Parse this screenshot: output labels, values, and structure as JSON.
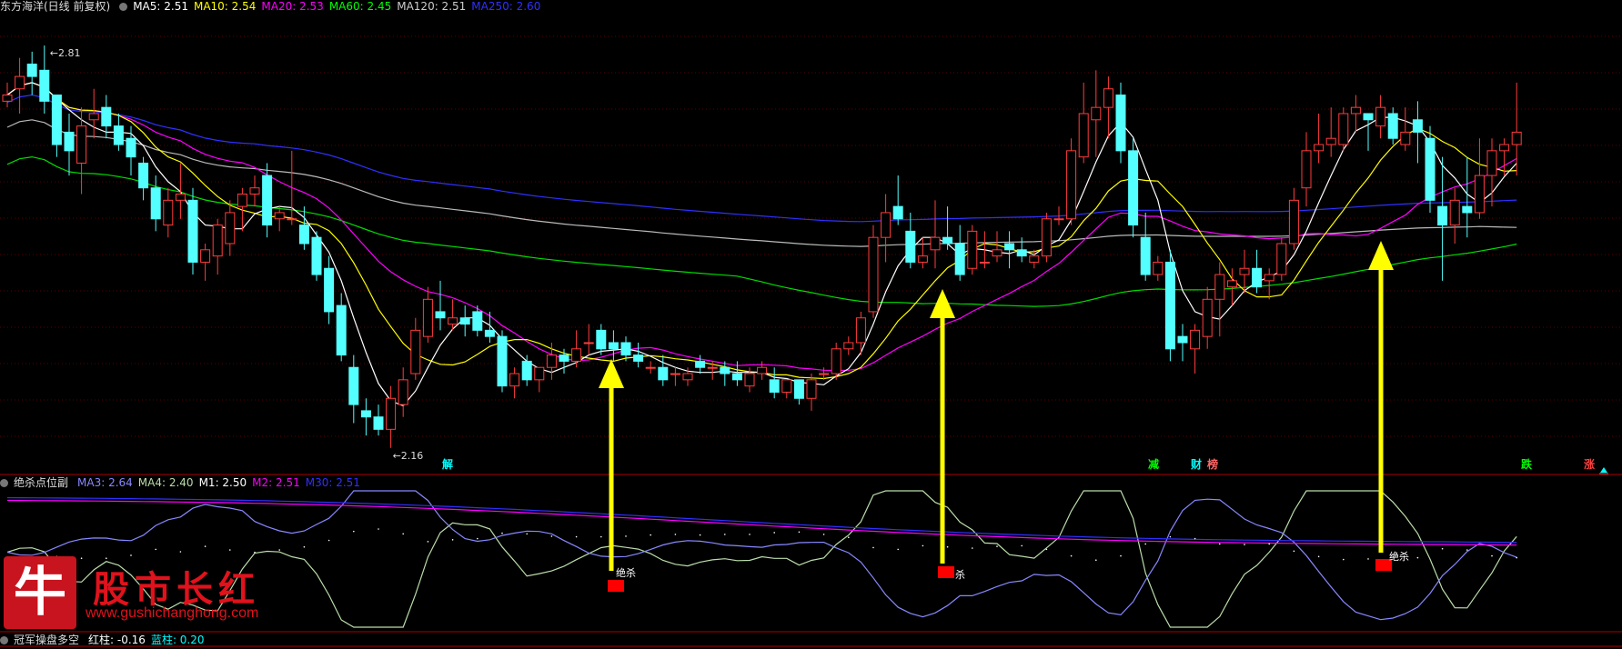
{
  "main_header": {
    "title": "东方海洋(日线 前复权)",
    "indicators": [
      {
        "label": "MA5: 2.51",
        "color": "#ffffff"
      },
      {
        "label": "MA10: 2.54",
        "color": "#ffff00"
      },
      {
        "label": "MA20: 2.53",
        "color": "#ff00ff"
      },
      {
        "label": "MA60: 2.45",
        "color": "#00ff00"
      },
      {
        "label": "MA120: 2.51",
        "color": "#cccccc"
      },
      {
        "label": "MA250: 2.60",
        "color": "#3030ff"
      }
    ]
  },
  "sub_header": {
    "title": "绝杀点位副",
    "indicators": [
      {
        "label": "MA3: 2.64",
        "color": "#8888ff"
      },
      {
        "label": "MA4: 2.40",
        "color": "#bbddaa"
      },
      {
        "label": "M1: 2.50",
        "color": "#ffffff"
      },
      {
        "label": "M2: 2.51",
        "color": "#ff00ff"
      },
      {
        "label": "M30: 2.51",
        "color": "#3030ff"
      }
    ]
  },
  "bottom_header": {
    "title": "冠军操盘多空",
    "indicators": [
      {
        "label": "红柱: -0.16",
        "color": "#ffffff"
      },
      {
        "label": "蓝柱: 0.20",
        "color": "#00ffff"
      }
    ]
  },
  "chart_data": {
    "type": "candlestick",
    "ylim": [
      2.12,
      2.86
    ],
    "high_label": "2.81",
    "low_label": "2.16",
    "candles": [
      [
        2.72,
        2.75,
        2.71,
        2.73
      ],
      [
        2.74,
        2.79,
        2.7,
        2.76
      ],
      [
        2.78,
        2.8,
        2.73,
        2.76
      ],
      [
        2.77,
        2.81,
        2.7,
        2.72
      ],
      [
        2.73,
        2.73,
        2.63,
        2.65
      ],
      [
        2.67,
        2.7,
        2.6,
        2.64
      ],
      [
        2.62,
        2.71,
        2.57,
        2.68
      ],
      [
        2.69,
        2.74,
        2.66,
        2.7
      ],
      [
        2.71,
        2.73,
        2.66,
        2.68
      ],
      [
        2.68,
        2.7,
        2.64,
        2.65
      ],
      [
        2.66,
        2.68,
        2.6,
        2.63
      ],
      [
        2.62,
        2.63,
        2.56,
        2.58
      ],
      [
        2.58,
        2.6,
        2.51,
        2.53
      ],
      [
        2.52,
        2.58,
        2.5,
        2.56
      ],
      [
        2.56,
        2.62,
        2.53,
        2.57
      ],
      [
        2.56,
        2.58,
        2.44,
        2.46
      ],
      [
        2.46,
        2.49,
        2.43,
        2.48
      ],
      [
        2.47,
        2.53,
        2.44,
        2.52
      ],
      [
        2.49,
        2.56,
        2.47,
        2.54
      ],
      [
        2.55,
        2.58,
        2.51,
        2.57
      ],
      [
        2.57,
        2.6,
        2.55,
        2.58
      ],
      [
        2.6,
        2.62,
        2.5,
        2.52
      ],
      [
        2.53,
        2.55,
        2.51,
        2.54
      ],
      [
        2.53,
        2.64,
        2.52,
        2.53
      ],
      [
        2.52,
        2.55,
        2.48,
        2.49
      ],
      [
        2.5,
        2.51,
        2.43,
        2.44
      ],
      [
        2.45,
        2.47,
        2.36,
        2.38
      ],
      [
        2.39,
        2.41,
        2.3,
        2.31
      ],
      [
        2.29,
        2.31,
        2.2,
        2.23
      ],
      [
        2.22,
        2.24,
        2.18,
        2.21
      ],
      [
        2.21,
        2.23,
        2.18,
        2.19
      ],
      [
        2.19,
        2.26,
        2.16,
        2.24
      ],
      [
        2.23,
        2.29,
        2.21,
        2.27
      ],
      [
        2.28,
        2.37,
        2.27,
        2.35
      ],
      [
        2.34,
        2.42,
        2.33,
        2.4
      ],
      [
        2.38,
        2.43,
        2.35,
        2.37
      ],
      [
        2.36,
        2.4,
        2.35,
        2.37
      ],
      [
        2.37,
        2.39,
        2.34,
        2.36
      ],
      [
        2.38,
        2.39,
        2.34,
        2.35
      ],
      [
        2.35,
        2.38,
        2.33,
        2.34
      ],
      [
        2.34,
        2.35,
        2.25,
        2.26
      ],
      [
        2.26,
        2.29,
        2.24,
        2.28
      ],
      [
        2.3,
        2.31,
        2.26,
        2.27
      ],
      [
        2.27,
        2.29,
        2.25,
        2.29
      ],
      [
        2.29,
        2.33,
        2.27,
        2.31
      ],
      [
        2.31,
        2.32,
        2.28,
        2.3
      ],
      [
        2.3,
        2.35,
        2.29,
        2.32
      ],
      [
        2.33,
        2.36,
        2.31,
        2.33
      ],
      [
        2.35,
        2.36,
        2.31,
        2.32
      ],
      [
        2.33,
        2.35,
        2.3,
        2.32
      ],
      [
        2.33,
        2.34,
        2.3,
        2.31
      ],
      [
        2.31,
        2.33,
        2.29,
        2.3
      ],
      [
        2.29,
        2.3,
        2.28,
        2.29
      ],
      [
        2.29,
        2.31,
        2.26,
        2.27
      ],
      [
        2.28,
        2.29,
        2.26,
        2.28
      ],
      [
        2.27,
        2.29,
        2.26,
        2.28
      ],
      [
        2.3,
        2.31,
        2.28,
        2.29
      ],
      [
        2.29,
        2.3,
        2.27,
        2.29
      ],
      [
        2.29,
        2.3,
        2.26,
        2.28
      ],
      [
        2.28,
        2.3,
        2.26,
        2.27
      ],
      [
        2.26,
        2.29,
        2.25,
        2.28
      ],
      [
        2.28,
        2.3,
        2.27,
        2.29
      ],
      [
        2.27,
        2.29,
        2.24,
        2.25
      ],
      [
        2.25,
        2.27,
        2.24,
        2.27
      ],
      [
        2.27,
        2.27,
        2.23,
        2.24
      ],
      [
        2.24,
        2.28,
        2.22,
        2.27
      ],
      [
        2.28,
        2.29,
        2.27,
        2.28
      ],
      [
        2.28,
        2.33,
        2.27,
        2.32
      ],
      [
        2.32,
        2.34,
        2.31,
        2.33
      ],
      [
        2.33,
        2.38,
        2.31,
        2.37
      ],
      [
        2.38,
        2.52,
        2.37,
        2.5
      ],
      [
        2.5,
        2.57,
        2.46,
        2.54
      ],
      [
        2.55,
        2.6,
        2.52,
        2.53
      ],
      [
        2.51,
        2.54,
        2.45,
        2.46
      ],
      [
        2.46,
        2.5,
        2.45,
        2.47
      ],
      [
        2.48,
        2.56,
        2.45,
        2.5
      ],
      [
        2.5,
        2.55,
        2.48,
        2.49
      ],
      [
        2.49,
        2.52,
        2.43,
        2.44
      ],
      [
        2.45,
        2.52,
        2.44,
        2.51
      ],
      [
        2.46,
        2.51,
        2.45,
        2.46
      ],
      [
        2.47,
        2.51,
        2.46,
        2.48
      ],
      [
        2.49,
        2.51,
        2.45,
        2.48
      ],
      [
        2.48,
        2.5,
        2.46,
        2.47
      ],
      [
        2.46,
        2.48,
        2.45,
        2.47
      ],
      [
        2.47,
        2.54,
        2.46,
        2.53
      ],
      [
        2.53,
        2.55,
        2.52,
        2.53
      ],
      [
        2.53,
        2.66,
        2.52,
        2.64
      ],
      [
        2.63,
        2.75,
        2.62,
        2.7
      ],
      [
        2.69,
        2.77,
        2.63,
        2.71
      ],
      [
        2.71,
        2.76,
        2.66,
        2.74
      ],
      [
        2.73,
        2.75,
        2.62,
        2.64
      ],
      [
        2.64,
        2.66,
        2.5,
        2.52
      ],
      [
        2.5,
        2.54,
        2.43,
        2.44
      ],
      [
        2.44,
        2.47,
        2.43,
        2.46
      ],
      [
        2.46,
        2.48,
        2.3,
        2.32
      ],
      [
        2.34,
        2.36,
        2.3,
        2.33
      ],
      [
        2.32,
        2.36,
        2.28,
        2.35
      ],
      [
        2.34,
        2.42,
        2.32,
        2.4
      ],
      [
        2.4,
        2.46,
        2.34,
        2.44
      ],
      [
        2.42,
        2.45,
        2.39,
        2.43
      ],
      [
        2.44,
        2.48,
        2.41,
        2.45
      ],
      [
        2.45,
        2.48,
        2.41,
        2.42
      ],
      [
        2.43,
        2.45,
        2.4,
        2.44
      ],
      [
        2.44,
        2.5,
        2.43,
        2.49
      ],
      [
        2.49,
        2.58,
        2.48,
        2.56
      ],
      [
        2.58,
        2.67,
        2.55,
        2.64
      ],
      [
        2.64,
        2.7,
        2.62,
        2.65
      ],
      [
        2.65,
        2.71,
        2.63,
        2.66
      ],
      [
        2.65,
        2.71,
        2.64,
        2.7
      ],
      [
        2.7,
        2.73,
        2.67,
        2.71
      ],
      [
        2.7,
        2.7,
        2.64,
        2.69
      ],
      [
        2.68,
        2.73,
        2.66,
        2.71
      ],
      [
        2.7,
        2.71,
        2.65,
        2.66
      ],
      [
        2.65,
        2.71,
        2.64,
        2.67
      ],
      [
        2.69,
        2.72,
        2.62,
        2.67
      ],
      [
        2.66,
        2.68,
        2.54,
        2.56
      ],
      [
        2.55,
        2.63,
        2.43,
        2.52
      ],
      [
        2.52,
        2.58,
        2.49,
        2.56
      ],
      [
        2.55,
        2.63,
        2.5,
        2.54
      ],
      [
        2.54,
        2.66,
        2.53,
        2.6
      ],
      [
        2.6,
        2.66,
        2.55,
        2.64
      ],
      [
        2.64,
        2.66,
        2.6,
        2.65
      ],
      [
        2.65,
        2.75,
        2.6,
        2.67
      ]
    ]
  },
  "signals": {
    "main": [
      {
        "text": "解",
        "color": "#00ffff"
      },
      {
        "text": "减",
        "color": "#00ff00"
      },
      {
        "text": "财",
        "color": "#00ffff"
      },
      {
        "text": "榜",
        "color": "#ff6666"
      },
      {
        "text": "跌",
        "color": "#00ff00"
      },
      {
        "text": "涨",
        "color": "#ff4040"
      }
    ],
    "sub": [
      {
        "text": "绝杀"
      },
      {
        "text": "杀"
      },
      {
        "text": "绝杀"
      }
    ]
  },
  "watermark": {
    "logo_char": "牛",
    "name": "股市长红",
    "url": "www.gushichanghong.com"
  }
}
